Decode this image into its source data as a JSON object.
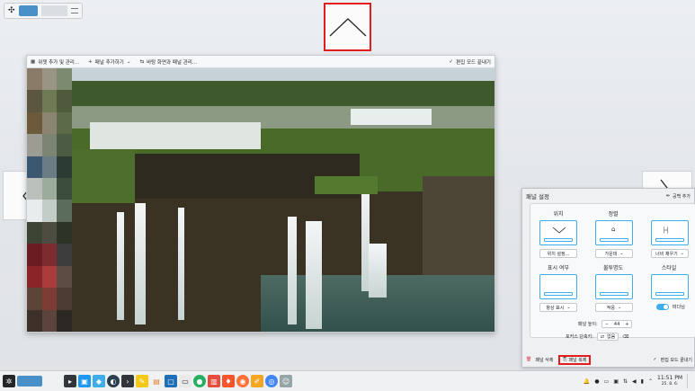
{
  "desktop_toolbar": {
    "widgets_label": "위젯 추가 및 관리...",
    "add_panel_label": "패널 추가하기",
    "manage_desktops_label": "바탕 화면과 패널 관리...",
    "done_label": "편집 모드 끝내기"
  },
  "panel_settings": {
    "title": "패널 설정",
    "spacer_label": "공백 추가",
    "position": {
      "label": "위치",
      "value": "위치 설정..."
    },
    "alignment": {
      "label": "정렬",
      "value": "가운데"
    },
    "width": {
      "value": "너비 채우기"
    },
    "visibility": {
      "label": "표시 여부",
      "value": "항상 표시"
    },
    "opacity": {
      "label": "불투명도",
      "value": "적응"
    },
    "style": {
      "label": "스타일",
      "toggle_label": "떠다님"
    },
    "panel_height": {
      "label": "패널 높이:",
      "value": "44"
    },
    "focus_shortcut": {
      "label": "포커스 단축키:",
      "value": "없음"
    },
    "delete_widgets_label": "패널 삭제",
    "delete_panel_label": "패널 복제",
    "done_label": "편집 모드 끝내기"
  },
  "taskbar": {
    "clock_time": "11:51 PM",
    "clock_date": "25. 8. 6."
  },
  "colors": {
    "accent": "#3daee9",
    "highlight_border": "#e11d1d"
  }
}
